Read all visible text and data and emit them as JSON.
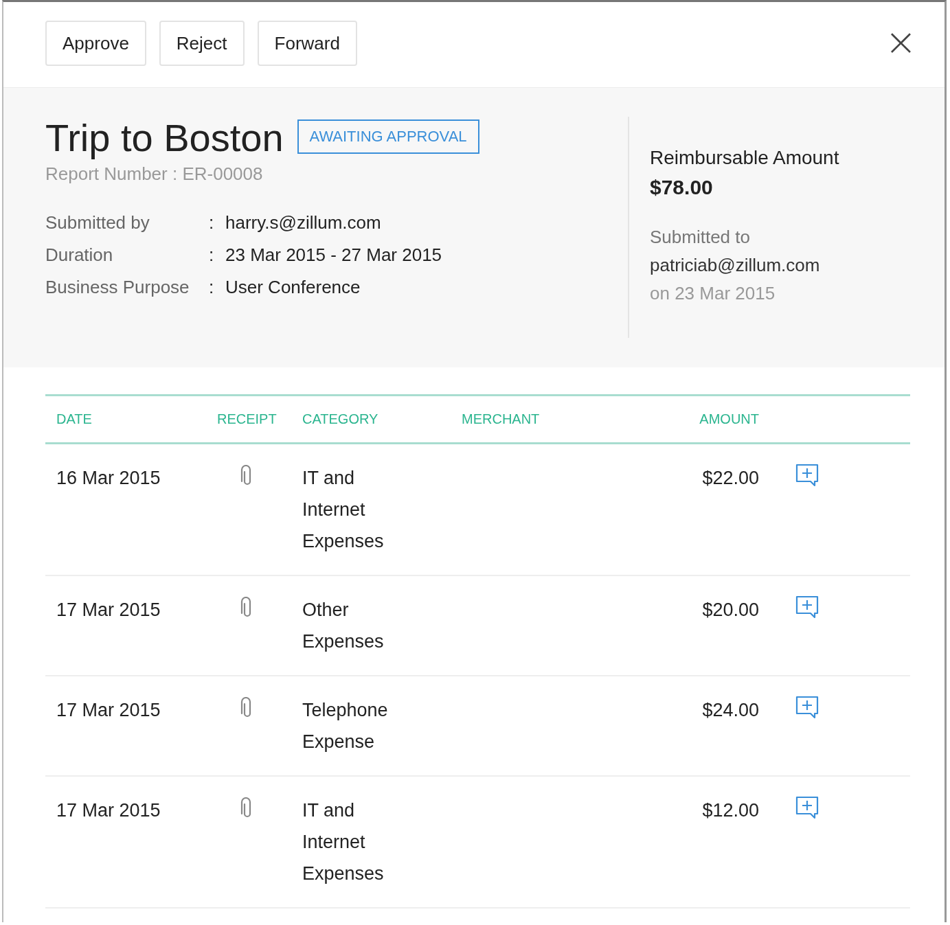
{
  "actions": [
    {
      "label": "Approve"
    },
    {
      "label": "Reject"
    },
    {
      "label": "Forward"
    }
  ],
  "close": {
    "glyph": "×"
  },
  "report": {
    "title": "Trip to Boston",
    "status": "AWAITING APPROVAL",
    "report_number": "Report Number : ER-00008",
    "details": [
      {
        "label": "Submitted by",
        "separator": ":",
        "value": "harry.s@zillum.com"
      },
      {
        "label": "Duration",
        "separator": ":",
        "value": "23 Mar 2015 - 27 Mar 2015"
      },
      {
        "label": "Business Purpose",
        "separator": ":",
        "value": "User Conference"
      }
    ]
  },
  "summary": {
    "amount_label": "Reimbursable Amount",
    "amount": "$78.00",
    "submitted_label": "Submitted to",
    "submitted_to": "patriciab@zillum.com",
    "submitted_on": "on 23 Mar 2015"
  },
  "table": {
    "columns": [
      "DATE",
      "RECEIPT",
      "CATEGORY",
      "MERCHANT",
      "AMOUNT"
    ],
    "rows": [
      {
        "date": "16 Mar 2015",
        "has_receipt": true,
        "category": "IT and Internet Expenses",
        "amount": "$22.00"
      },
      {
        "date": "17 Mar 2015",
        "has_receipt": true,
        "category": "Other Expenses",
        "amount": "$20.00"
      },
      {
        "date": "17 Mar 2015",
        "has_receipt": true,
        "category": "Telephone Expense",
        "amount": "$24.00"
      },
      {
        "date": "17 Mar 2015",
        "has_receipt": true,
        "category": "IT and Internet Expenses",
        "amount": "$12.00"
      }
    ]
  }
}
